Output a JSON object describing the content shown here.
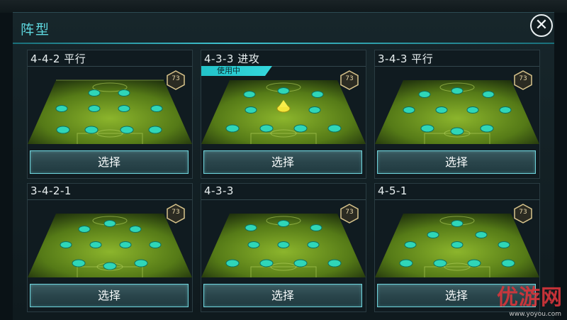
{
  "window": {
    "title": "阵型"
  },
  "colors": {
    "accent": "#3fc3d0",
    "player": "#2fd6b8",
    "pitch": "#6f9a1e",
    "badge": "#d8c48c"
  },
  "formations": [
    {
      "name": "4-4-2 平行",
      "rating": "73",
      "button": "选择",
      "in_use": false
    },
    {
      "name": "4-3-3 进攻",
      "rating": "73",
      "button": "选择",
      "in_use": true,
      "tag": "使用中"
    },
    {
      "name": "3-4-3 平行",
      "rating": "73",
      "button": "选择",
      "in_use": false
    },
    {
      "name": "3-4-2-1",
      "rating": "73",
      "button": "选择",
      "in_use": false
    },
    {
      "name": "4-3-3",
      "rating": "73",
      "button": "选择",
      "in_use": false
    },
    {
      "name": "4-5-1",
      "rating": "73",
      "button": "选择",
      "in_use": false
    }
  ],
  "watermark": {
    "text": "优游网",
    "url": "www.yoyou.com"
  }
}
